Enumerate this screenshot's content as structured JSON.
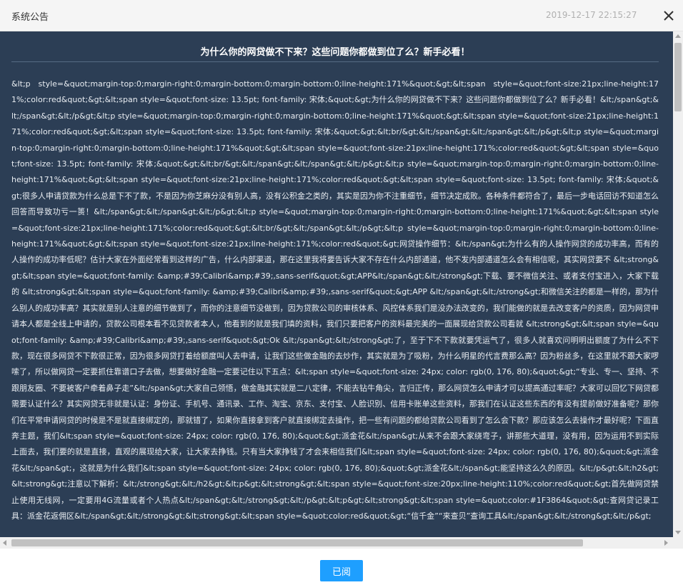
{
  "dialog": {
    "title": "系统公告",
    "timestamp": "2019-12-17 22:15:27",
    "close_icon": "close-icon"
  },
  "article": {
    "headline": "为什么你的网贷做不下来？这些问题你都做到位了么？新手必看！",
    "body": "&lt;p style=&quot;margin-top:0;margin-right:0;margin-bottom:0;margin-bottom:0;line-height:171%&quot;&gt;&lt;span style=&quot;font-size:21px;line-height:171%;color:red&quot;&gt;&lt;span style=&quot;font-size: 13.5pt; font-family: 宋体;&quot;&gt;为什么你的网贷做不下来？这些问题你都做到位了么？新手必看！&lt;/span&gt;&lt;/span&gt;&lt;/p&gt;&lt;p style=&quot;margin-top:0;margin-right:0;margin-bottom:0;line-height:171%&quot;&gt;&lt;span style=&quot;font-size:21px;line-height:171%;color:red&quot;&gt;&lt;span style=&quot;font-size: 13.5pt; font-family: 宋体;&quot;&gt;&lt;br/&gt;&lt;/span&gt;&lt;/span&gt;&lt;/p&gt;&lt;p style=&quot;margin-top:0;margin-right:0;margin-bottom:0;line-height:171%&quot;&gt;&lt;span style=&quot;font-size:21px;line-height:171%;color:red&quot;&gt;&lt;span style=&quot;font-size: 13.5pt; font-family: 宋体;&quot;&gt;&lt;br/&gt;&lt;/span&gt;&lt;/span&gt;&lt;/p&gt;&lt;p style=&quot;margin-top:0;margin-right:0;margin-bottom:0;line-height:171%&quot;&gt;&lt;span style=&quot;font-size:21px;line-height:171%;color:red&quot;&gt;&lt;span style=&quot;font-size: 13.5pt; font-family: 宋体;&quot;&gt;很多人申请贷款为什么总是下不了款，不是因为你芝麻分没有别人高，没有公积金之类的，其实是因为你不注重细节，细节决定成败。各种条件都符合了，最后一步电话回访不知道怎么回答而导致功亏一篑！&lt;/span&gt;&lt;/span&gt;&lt;/p&gt;&lt;p style=&quot;margin-top:0;margin-right:0;margin-bottom:0;line-height:171%&quot;&gt;&lt;span style=&quot;font-size:21px;line-height:171%;color:red&quot;&gt;&lt;br/&gt;&lt;/span&gt;&lt;/p&gt;&lt;p style=&quot;margin-top:0;margin-right:0;margin-bottom:0;line-height:171%&quot;&gt;&lt;span style=&quot;font-size:21px;line-height:171%;color:red&quot;&gt;网贷操作细节：&lt;/span&gt;为什么有的人操作网贷的成功率高，而有的人操作的成功率低呢？估计大家在外面经常看到这样的广告，什么内部渠道，那在这里我将要告诉大家不存在什么内部通道，他不发内部通道怎么会有相信呢，其实网贷要不 &lt;strong&gt;&lt;span style=&quot;font-family: &amp;#39;Calibri&amp;#39;,sans-serif&quot;&gt;APP&lt;/span&gt;&lt;/strong&gt;下载、要不微信关注、或者支付宝进入，大家下载的 &lt;strong&gt;&lt;span style=&quot;font-family: &amp;#39;Calibri&amp;#39;,sans-serif&quot;&gt;APP &lt;/span&gt;&lt;/strong&gt;和微信关注的都是一样的，那为什么别人的成功率高？其实就是别人注意的细节做到了，而你的注意细节没做到，因为贷款公司的审核体系、风控体系我们是没办法改变的，我们能做的就是去改变客户的资质，因为网贷申请本人都是全线上申请的，贷款公司根本看不见贷款者本人，他看到的就是我们填的资料，我们只要把客户的资料最完美的一面展现给贷款公司看就 &lt;strong&gt;&lt;span style=&quot;font-family: &amp;#39;Calibri&amp;#39;,sans-serif&quot;&gt;Ok &lt;/span&gt;&lt;/strong&gt;了，至于下不下款就要凭运气了，很多人就喜欢问明明出额度了为什么不下款，现在很多网贷不下款很正常，因为很多网贷打着给额度叫人去申请，让我们这些做金融的去炒作，其实就是为了吸粉，为什么明星的代言费那么高？因为粉丝多，在这里就不跟大家啰嗦了，所以做网贷一定要抓住靠谱口子去做，想要做好金融一定要记住以下五点：&lt;span style=&quot;font-size: 24px; color: rgb(0, 176, 80);&quot;&gt;“专业、专一、坚持、不跟朋友圈、不要被客户牵着鼻子走”&lt;/span&gt;大家自己领悟，做金融其实就是二八定律，不能去钻牛角尖，言归正传，那么网贷怎么申请才可以提高通过率呢？大家可以回忆下网贷都需要认证什么？其实网贷无非就是认证：身份证、手机号、通讯录、工作、淘宝、京东、支付宝、人脸识别、信用卡账单这些资料，那我们在认证这些东西的有没有提前做好准备呢？那你们在平常申请网贷的时候是不是就直接绑定的，那就错了，如果你直接拿到客户就直接绑定去操作，把一些有问题的都给贷款公司看到了怎么会下款？那应该怎么去操作才最好呢？下面直奔主题，我们&lt;span style=&quot;font-size: 24px; color: rgb(0, 176, 80);&quot;&gt;派金花&lt;/span&gt;从来不会跟大家绕弯子，讲那些大道理，没有用，因为运用不到实际上面去，我们要的就是直接，直观的展现给大家，让大家去挣钱。只有当大家挣钱了才会来相信我们&lt;span style=&quot;font-size: 24px; color: rgb(0, 176, 80);&quot;&gt;派金花&lt;/span&gt;，这就是为什么我们&lt;span style=&quot;font-size: 24px; color: rgb(0, 176, 80);&quot;&gt;派金花&lt;/span&gt;能坚持这么久的原因。&lt;/p&gt;&lt;h2&gt;&lt;strong&gt;注意以下解析：&lt;/strong&gt;&lt;/h2&gt;&lt;p&gt;&lt;strong&gt;&lt;span style=&quot;font-size:20px;line-height:110%;color:red&quot;&gt;首先做网贷禁止使用无线网，一定要用4G流量或者个人热点&lt;/span&gt;&lt;/strong&gt;&lt;/p&gt;&lt;p&gt;&lt;strong&gt;&lt;span style=&quot;color:#1F3864&quot;&gt;查网贷记录工具：派金花返佣区&lt;/span&gt;&lt;/strong&gt;&lt;strong&gt;&lt;span style=&quot;color:red&quot;&gt;“信千金”“来查贝”查询工具&lt;/span&gt;&lt;/strong&gt;&lt;/p&gt;"
  },
  "footer": {
    "read_button_label": "已阅"
  },
  "colors": {
    "panel_background": "#2c3e55",
    "button_accent": "#1e9fff"
  }
}
